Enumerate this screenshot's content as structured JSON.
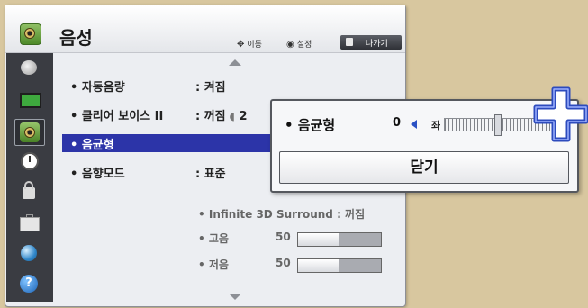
{
  "header": {
    "title": "음성",
    "hint_move": "이동",
    "hint_set": "설정",
    "exit_label": "나가기",
    "icon": "speaker-icon"
  },
  "sidebar": {
    "items": [
      {
        "icon": "satellite-icon"
      },
      {
        "icon": "tv-icon"
      },
      {
        "icon": "speaker-icon",
        "active": true
      },
      {
        "icon": "clock-icon"
      },
      {
        "icon": "lock-icon"
      },
      {
        "icon": "briefcase-icon"
      },
      {
        "icon": "globe-icon"
      },
      {
        "icon": "help-icon",
        "glyph": "?"
      }
    ]
  },
  "menu": {
    "items": [
      {
        "label": "• 자동음량",
        "value": ": 켜짐"
      },
      {
        "label": "• 클리어 보이스 II",
        "value": ": 꺼짐",
        "extra_value": "2"
      },
      {
        "label": "• 음균형",
        "value": ""
      },
      {
        "label": "• 음향모드",
        "value": ": 표준"
      }
    ],
    "sub_items": [
      {
        "label": "• Infinite 3D Surround : 꺼짐"
      },
      {
        "label": "• 고음",
        "value": "50",
        "level": 0.5
      },
      {
        "label": "• 저음",
        "value": "50",
        "level": 0.5
      }
    ]
  },
  "popup": {
    "label": "• 음균형",
    "value": "0",
    "balance_left": "좌",
    "close_label": "닫기"
  },
  "colors": {
    "background": "#d8c79f",
    "selected_row": "#2c34a8",
    "sidebar": "#3a3c42"
  }
}
